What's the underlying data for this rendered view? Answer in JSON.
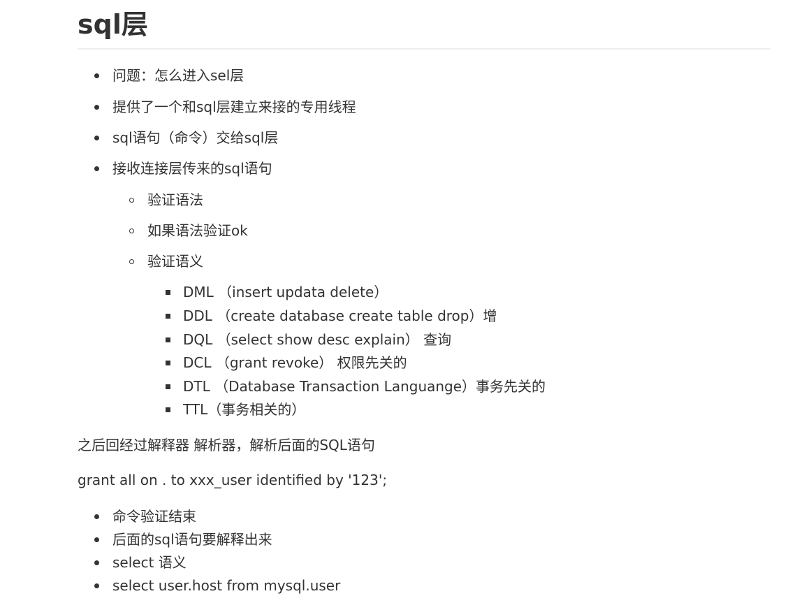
{
  "title": "sql层",
  "list1": [
    "问题：怎么进入sel层",
    "提供了一个和sql层建立来接的专用线程",
    "sql语句（命令）交给sql层",
    "接收连接层传来的sql语句"
  ],
  "list2": [
    "验证语法",
    "如果语法验证ok",
    "验证语义"
  ],
  "list3": [
    "DML （insert updata delete）",
    "DDL （create database create table drop）增",
    "DQL  （select show desc explain） 查询",
    "DCL   （grant revoke） 权限先关的",
    "DTL （Database Transaction Languange）事务先关的",
    "TTL（事务相关的）"
  ],
  "para1": "之后回经过解释器 解析器，解析后面的SQL语句",
  "para2": "grant all on . to xxx_user identified by '123';",
  "list4": [
    "命令验证结束",
    "后面的sql语句要解释出来",
    "select 语义",
    "select user.host from mysql.user"
  ]
}
